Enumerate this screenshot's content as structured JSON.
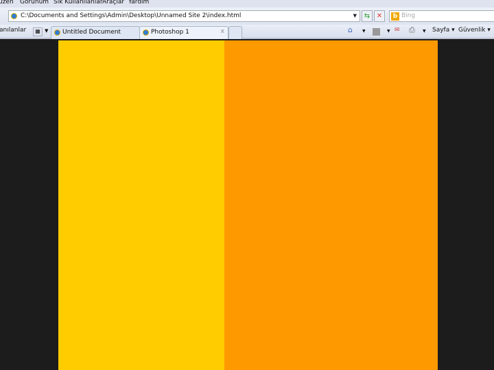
{
  "menu": [
    "üzen",
    "Görünüm",
    "Sık Kullanılanlar",
    "Araçlar",
    "Yardım"
  ],
  "address": {
    "url": "C:\\Documents and Settings\\Admin\\Desktop\\Unnamed Site 2\\index.html"
  },
  "search": {
    "placeholder": "Bing"
  },
  "favorites_label": "anılanlar",
  "tabs": [
    {
      "label": "Untitled Document"
    },
    {
      "label": "Photoshop 1",
      "close": "x"
    }
  ],
  "toolbar": {
    "page": "Sayfa ▾",
    "security": "Güvenlik ▾"
  },
  "colors": {
    "left": "#ffcc00",
    "right": "#ff9900",
    "background": "#1c1c1c"
  }
}
